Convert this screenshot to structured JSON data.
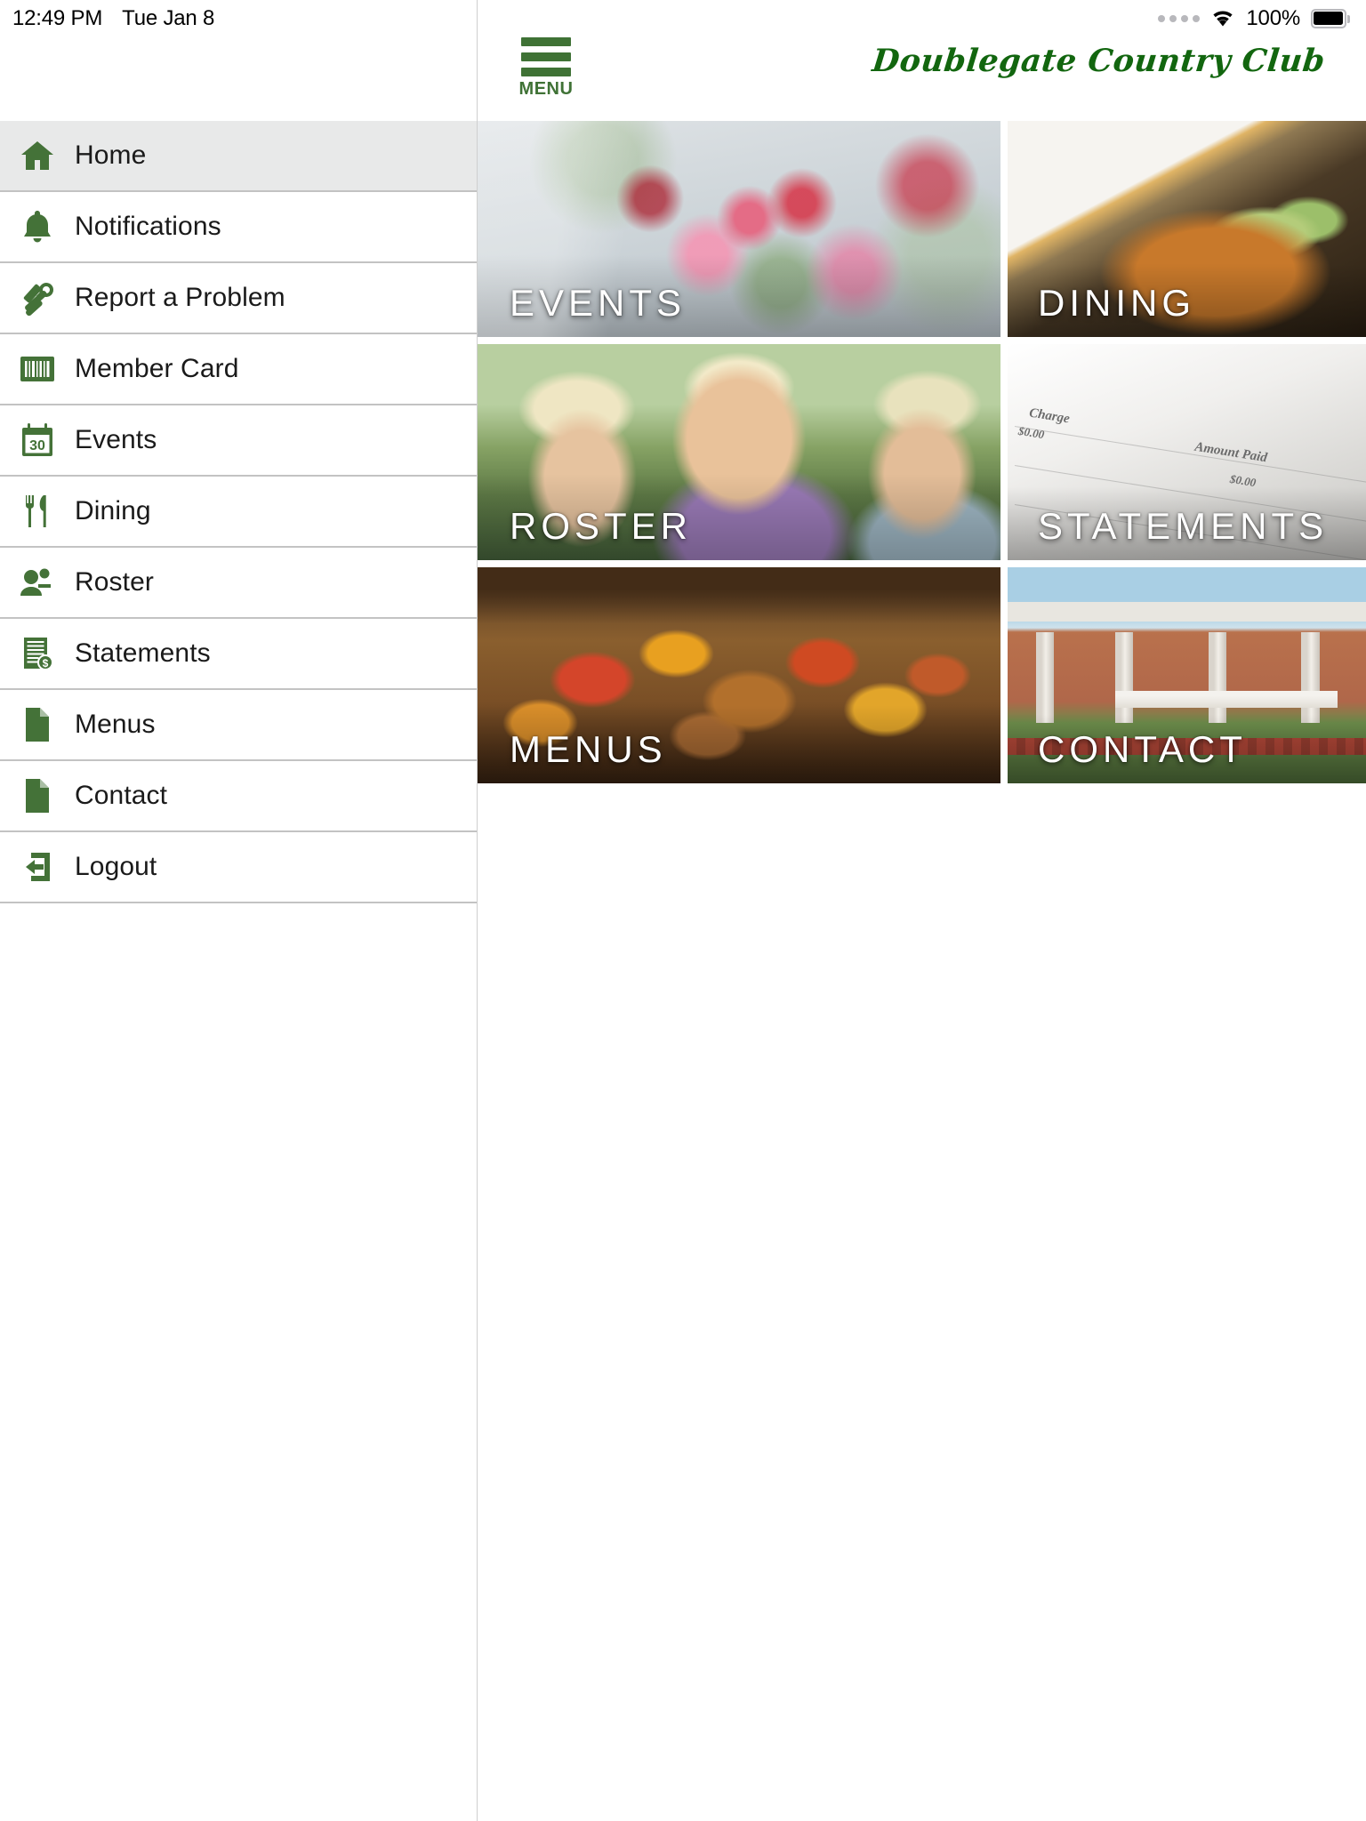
{
  "statusbar": {
    "time": "12:49 PM",
    "date": "Tue Jan 8",
    "battery_percent": "100%",
    "wifi_icon": "wifi-icon",
    "signal_icon": "signal-dots-icon",
    "battery_icon": "battery-full-icon"
  },
  "appbar": {
    "menu_label": "MENU",
    "brand": "Doublegate Country Club",
    "brand_color": "#12660f",
    "accent_color": "#3f7235"
  },
  "sidebar": {
    "active_index": 0,
    "active_bg": "#e8e9e9",
    "items": [
      {
        "label": "Home",
        "icon": "home-icon"
      },
      {
        "label": "Notifications",
        "icon": "bell-icon"
      },
      {
        "label": "Report a Problem",
        "icon": "hammer-wrench-icon"
      },
      {
        "label": "Member Card",
        "icon": "barcode-icon"
      },
      {
        "label": "Events",
        "icon": "calendar-icon"
      },
      {
        "label": "Dining",
        "icon": "fork-knife-icon"
      },
      {
        "label": "Roster",
        "icon": "people-icon"
      },
      {
        "label": "Statements",
        "icon": "invoice-dollar-icon"
      },
      {
        "label": "Menus",
        "icon": "document-icon"
      },
      {
        "label": "Contact",
        "icon": "document-icon"
      },
      {
        "label": "Logout",
        "icon": "logout-arrow-icon"
      }
    ]
  },
  "tiles": {
    "rows": [
      [
        {
          "label": "EVENTS",
          "photo": "banquet-table-flowers"
        },
        {
          "label": "DINING",
          "photo": "plated-chicken-dish"
        }
      ],
      [
        {
          "label": "ROSTER",
          "photo": "golfers-group"
        },
        {
          "label": "STATEMENTS",
          "photo": "billing-statement-paper"
        }
      ],
      [
        {
          "label": "MENUS",
          "photo": "kebab-skewers-pan"
        },
        {
          "label": "CONTACT",
          "photo": "clubhouse-building"
        }
      ]
    ],
    "statement_text": {
      "charge": "Charge",
      "amount_paid": "Amount Paid",
      "zero": "$0.00",
      "zero2": "$0.00"
    }
  },
  "calendar_icon_day": "30"
}
